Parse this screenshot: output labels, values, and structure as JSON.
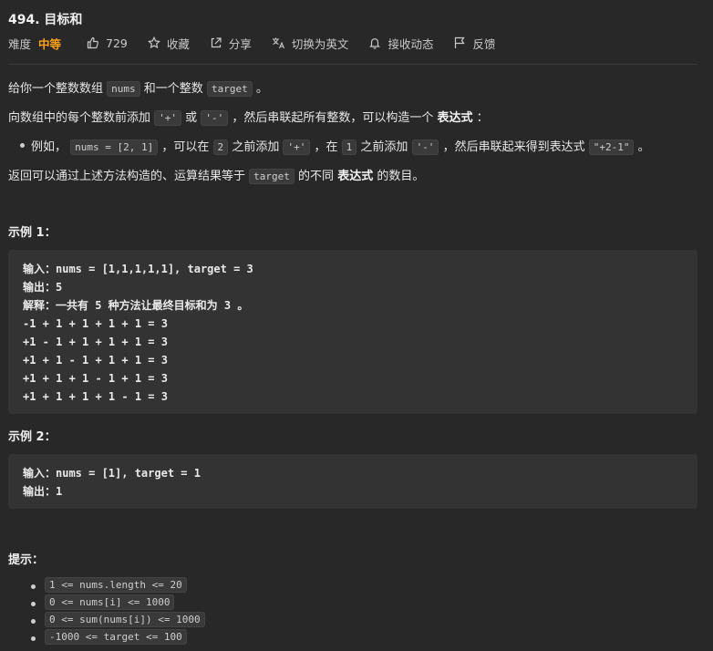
{
  "problem": {
    "title": "494. 目标和",
    "difficulty_label": "难度",
    "difficulty": "中等",
    "likes": "729",
    "favorite": "收藏",
    "share": "分享",
    "switch_lang": "切换为英文",
    "notify": "接收动态",
    "feedback": "反馈"
  },
  "description": {
    "p1_a": "给你一个整数数组",
    "p1_nums": "nums",
    "p1_b": "和一个整数",
    "p1_target": "target",
    "p1_c": "。",
    "p2_a": "向数组中的每个整数前添加",
    "p2_plus": "'+'",
    "p2_b": "或",
    "p2_minus": "'-'",
    "p2_c": "，然后串联起所有整数，可以构造一个",
    "p2_bold": "表达式",
    "p2_d": "：",
    "b1_a": "例如，",
    "b1_code1": "nums = [2, 1]",
    "b1_b": "，可以在",
    "b1_code2": "2",
    "b1_c": "之前添加",
    "b1_code3": "'+'",
    "b1_d": "，在",
    "b1_code4": "1",
    "b1_e": "之前添加",
    "b1_code5": "'-'",
    "b1_f": "，然后串联起来得到表达式",
    "b1_code6": "\"+2-1\"",
    "b1_g": "。",
    "p3_a": "返回可以通过上述方法构造的、运算结果等于",
    "p3_target": "target",
    "p3_b": "的不同",
    "p3_bold": "表达式",
    "p3_c": "的数目。"
  },
  "example1": {
    "heading": "示例 1：",
    "lines": [
      "输入：nums = [1,1,1,1,1], target = 3",
      "输出：5",
      "解释：一共有 5 种方法让最终目标和为 3 。",
      "-1 + 1 + 1 + 1 + 1 = 3",
      "+1 - 1 + 1 + 1 + 1 = 3",
      "+1 + 1 - 1 + 1 + 1 = 3",
      "+1 + 1 + 1 - 1 + 1 = 3",
      "+1 + 1 + 1 + 1 - 1 = 3"
    ]
  },
  "example2": {
    "heading": "示例 2：",
    "lines": [
      "输入：nums = [1], target = 1",
      "输出：1"
    ]
  },
  "hints": {
    "heading": "提示：",
    "items": [
      "1 <= nums.length <= 20",
      "0 <= nums[i] <= 1000",
      "0 <= sum(nums[i]) <= 1000",
      "-1000 <= target <= 100"
    ]
  },
  "icons": [
    "thumbs-up-icon",
    "star-icon",
    "share-icon",
    "translate-icon",
    "bell-icon",
    "flag-icon"
  ],
  "colors": {
    "background": "#282828",
    "accent": "#ffa116",
    "code_bg": "#333333"
  }
}
